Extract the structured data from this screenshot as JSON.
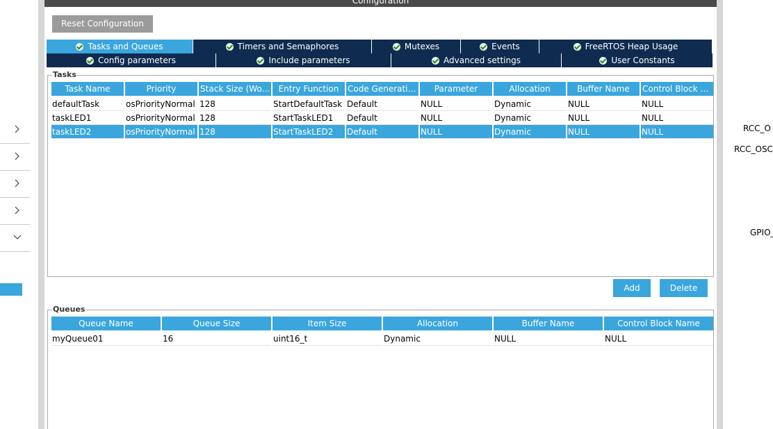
{
  "panel": {
    "title": "Configuration",
    "reset_label": "Reset Configuration"
  },
  "tabs_row1": [
    {
      "label": "Tasks and Queues",
      "active": true
    },
    {
      "label": "Timers and Semaphores"
    },
    {
      "label": "Mutexes"
    },
    {
      "label": "Events"
    },
    {
      "label": "FreeRTOS Heap Usage"
    }
  ],
  "tabs_row2": [
    {
      "label": "Config parameters"
    },
    {
      "label": "Include parameters"
    },
    {
      "label": "Advanced settings"
    },
    {
      "label": "User Constants"
    }
  ],
  "tasks": {
    "title": "Tasks",
    "headers": [
      "Task Name",
      "Priority",
      "Stack Size (Wo...",
      "Entry Function",
      "Code Generatio...",
      "Parameter",
      "Allocation",
      "Buffer Name",
      "Control Block N..."
    ],
    "rows": [
      [
        "defaultTask",
        "osPriorityNormal",
        "128",
        "StartDefaultTask",
        "Default",
        "NULL",
        "Dynamic",
        "NULL",
        "NULL"
      ],
      [
        "taskLED1",
        "osPriorityNormal",
        "128",
        "StartTaskLED1",
        "Default",
        "NULL",
        "Dynamic",
        "NULL",
        "NULL"
      ],
      [
        "taskLED2",
        "osPriorityNormal",
        "128",
        "StartTaskLED2",
        "Default",
        "NULL",
        "Dynamic",
        "NULL",
        "NULL"
      ]
    ],
    "selected_row": 2,
    "add_label": "Add",
    "delete_label": "Delete"
  },
  "queues": {
    "title": "Queues",
    "headers": [
      "Queue Name",
      "Queue Size",
      "Item Size",
      "Allocation",
      "Buffer Name",
      "Control Block Name"
    ],
    "rows": [
      [
        "myQueue01",
        "16",
        "uint16_t",
        "Dynamic",
        "NULL",
        "NULL"
      ]
    ]
  },
  "right_labels": [
    "RCC_O",
    "RCC_OSC",
    "GPIO_"
  ],
  "colors": {
    "accent": "#3aa6dd",
    "tab_dark": "#0f2b4f",
    "button_gray": "#9b9b9b"
  }
}
